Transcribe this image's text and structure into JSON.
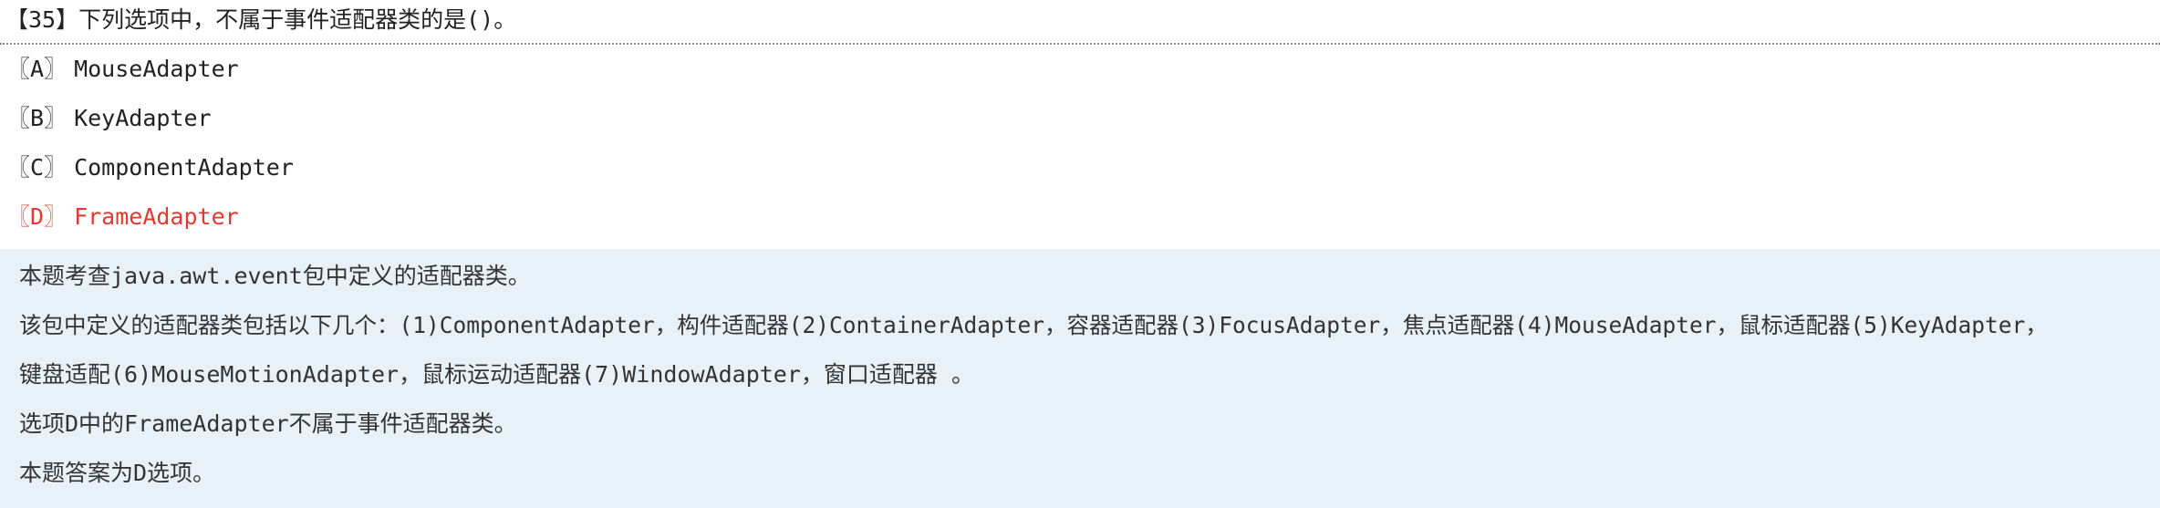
{
  "question": {
    "text": "【35】下列选项中，不属于事件适配器类的是()。"
  },
  "options": [
    {
      "mark": "〖A〗",
      "text": "MouseAdapter",
      "correct": false
    },
    {
      "mark": "〖B〗",
      "text": "KeyAdapter",
      "correct": false
    },
    {
      "mark": "〖C〗",
      "text": "ComponentAdapter",
      "correct": false
    },
    {
      "mark": "〖D〗",
      "text": "FrameAdapter",
      "correct": true
    }
  ],
  "colors": {
    "correct": "#e23a30",
    "explanation_bg": "#e9f1f8",
    "text": "#222222"
  },
  "explanation": {
    "lines": [
      "本题考查java.awt.event包中定义的适配器类。",
      "该包中定义的适配器类包括以下几个：(1)ComponentAdapter，构件适配器(2)ContainerAdapter，容器适配器(3)FocusAdapter，焦点适配器(4)MouseAdapter，鼠标适配器(5)KeyAdapter，",
      "键盘适配(6)MouseMotionAdapter，鼠标运动适配器(7)WindowAdapter，窗口适配器 。",
      "选项D中的FrameAdapter不属于事件适配器类。",
      "本题答案为D选项。"
    ]
  }
}
